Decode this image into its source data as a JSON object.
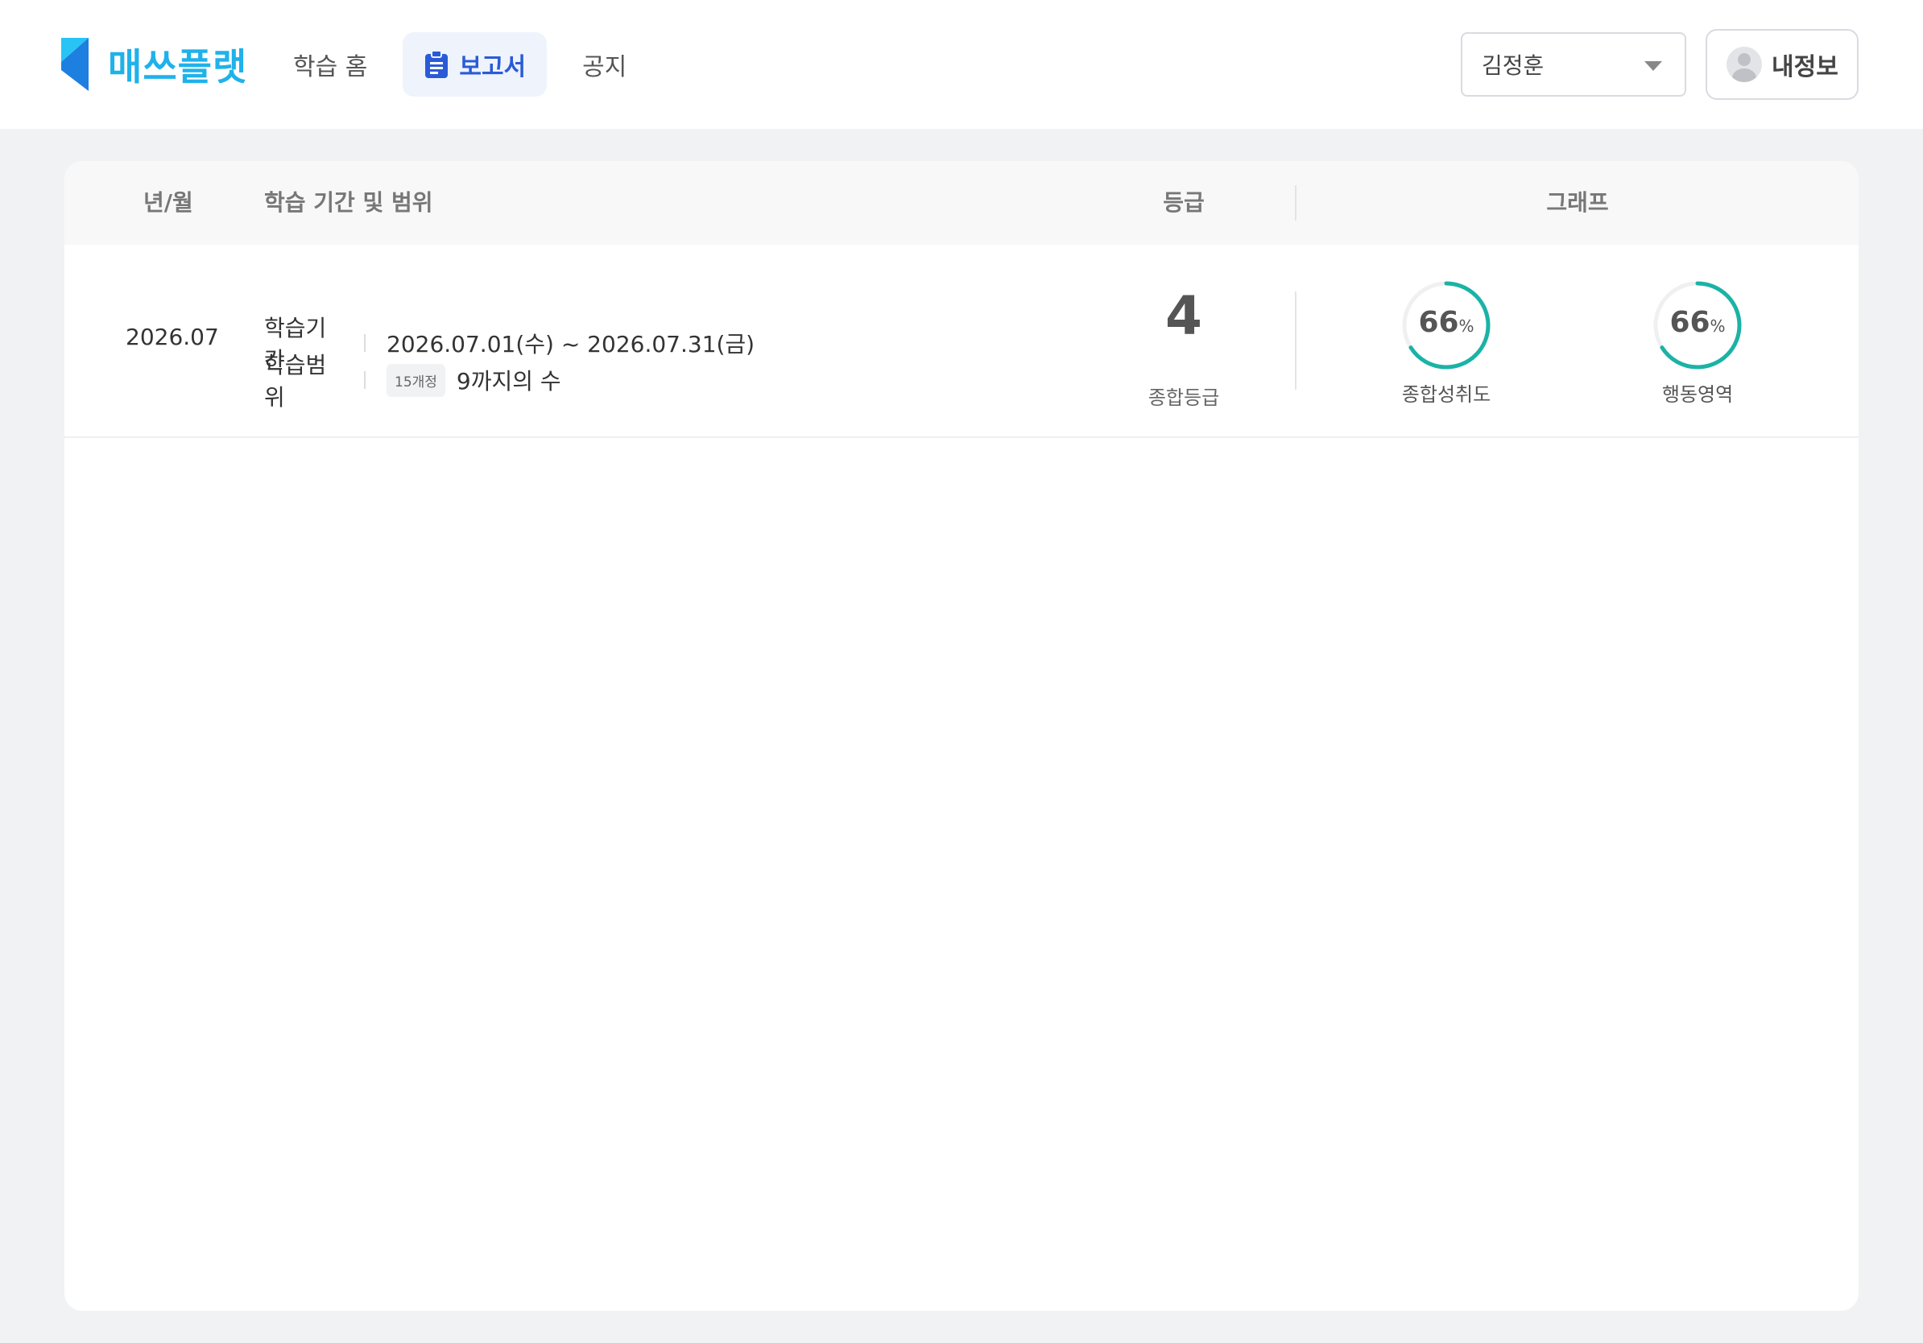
{
  "brand": {
    "name": "매쓰플랫",
    "accent_color": "#1fb2ea"
  },
  "nav": {
    "items": [
      {
        "label": "학습 홈",
        "active": false
      },
      {
        "label": "보고서",
        "active": true,
        "icon": "clipboard-icon"
      },
      {
        "label": "공지",
        "active": false
      }
    ],
    "active_color": "#2a5bd7"
  },
  "student_select": {
    "value": "김정훈"
  },
  "myinfo": {
    "label": "내정보",
    "icon": "avatar-icon"
  },
  "table": {
    "headers": {
      "year_month": "년/월",
      "period_range": "학습 기간 및 범위",
      "grade": "등급",
      "graph": "그래프"
    },
    "rows": [
      {
        "year_month": "2026.07",
        "period_label": "학습기간",
        "period_value": "2026.07.01(수) ~ 2026.07.31(금)",
        "range_label": "학습범위",
        "range_tag": "15개정",
        "range_value": "9까지의 수",
        "grade_value": "4",
        "grade_label": "종합등급",
        "gauges": [
          {
            "value": 66,
            "unit": "%",
            "label": "종합성취도",
            "color": "#1ab3a6"
          },
          {
            "value": 66,
            "unit": "%",
            "label": "행동영역",
            "color": "#1ab3a6"
          }
        ]
      }
    ]
  }
}
